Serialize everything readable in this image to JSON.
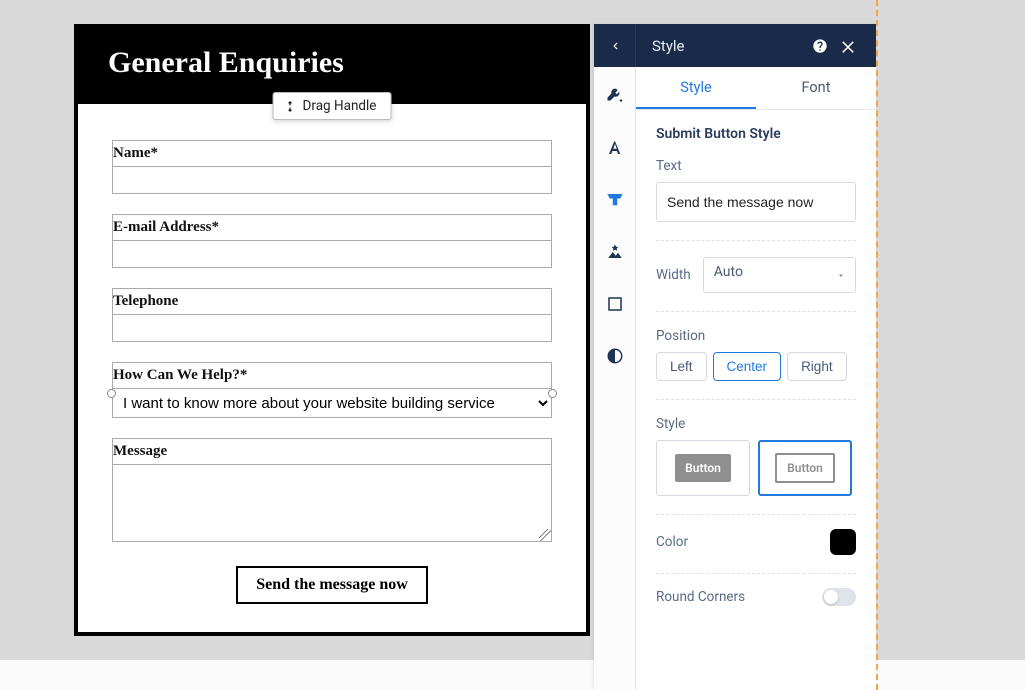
{
  "form": {
    "title": "General Enquiries",
    "drag_handle": "Drag Handle",
    "fields": {
      "name_label": "Name*",
      "email_label": "E-mail Address*",
      "phone_label": "Telephone",
      "help_label": "How Can We Help?*",
      "help_selected": "I want to know more about your website building service",
      "message_label": "Message"
    },
    "submit_label": "Send the message now"
  },
  "panel": {
    "title": "Style",
    "tabs": {
      "style": "Style",
      "font": "Font"
    },
    "section_title": "Submit Button Style",
    "text_label": "Text",
    "text_value": "Send the message now",
    "width_label": "Width",
    "width_value": "Auto",
    "position_label": "Position",
    "position": {
      "left": "Left",
      "center": "Center",
      "right": "Right"
    },
    "style_label": "Style",
    "style_btn_label": "Button",
    "color_label": "Color",
    "color_value": "#000000",
    "round_label": "Round Corners"
  }
}
